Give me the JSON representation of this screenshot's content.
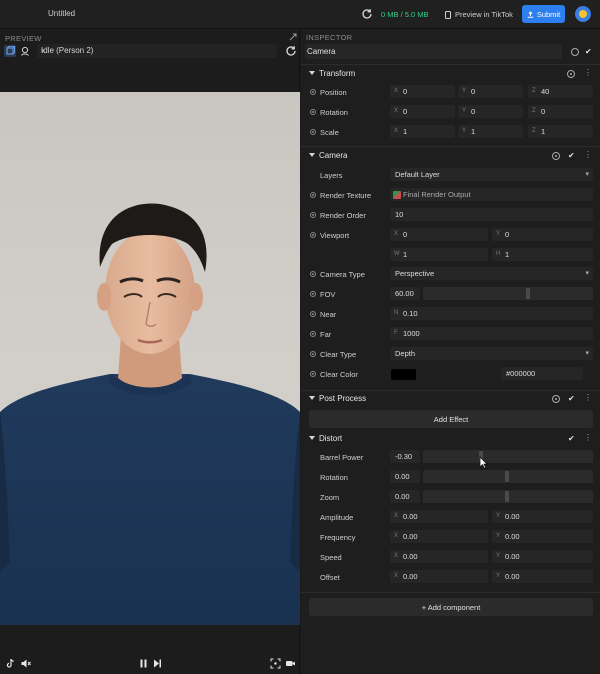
{
  "topbar": {
    "title": "Untitled",
    "memory": "0 MB / 5.0 MB",
    "preview_label": "Preview in TikTok",
    "submit_label": "Submit"
  },
  "preview": {
    "panel_label": "PREVIEW",
    "person_select": "Idle (Person 2)"
  },
  "inspector": {
    "panel_label": "INSPECTOR",
    "object_name": "Camera",
    "transform": {
      "title": "Transform",
      "position": {
        "label": "Position",
        "x": "0",
        "y": "0",
        "z": "40"
      },
      "rotation": {
        "label": "Rotation",
        "x": "0",
        "y": "0",
        "z": "0"
      },
      "scale": {
        "label": "Scale",
        "x": "1",
        "y": "1",
        "z": "1"
      }
    },
    "camera": {
      "title": "Camera",
      "layers_label": "Layers",
      "layers_value": "Default Layer",
      "render_texture_label": "Render Texture",
      "render_texture_value": "Final Render Output",
      "render_order_label": "Render Order",
      "render_order_value": "10",
      "viewport_label": "Viewport",
      "viewport": {
        "x": "0",
        "y": "0",
        "w": "1",
        "h": "1"
      },
      "camera_type_label": "Camera Type",
      "camera_type_value": "Perspective",
      "fov_label": "FOV",
      "fov_value": "60.00",
      "fov_fraction": 0.62,
      "near_label": "Near",
      "near_value": "0.10",
      "far_label": "Far",
      "far_value": "1000",
      "clear_type_label": "Clear Type",
      "clear_type_value": "Depth",
      "clear_color_label": "Clear Color",
      "clear_color_hex": "#000000"
    },
    "post_process": {
      "title": "Post Process",
      "add_effect_label": "Add Effect"
    },
    "distort": {
      "title": "Distort",
      "barrel_power_label": "Barrel Power",
      "barrel_power_value": "-0.30",
      "rotation_label": "Rotation",
      "rotation_value": "0.00",
      "zoom_label": "Zoom",
      "zoom_value": "0.00",
      "amplitude_label": "Amplitude",
      "amplitude": {
        "x": "0.00",
        "y": "0.00"
      },
      "frequency_label": "Frequency",
      "frequency": {
        "x": "0.00",
        "y": "0.00"
      },
      "speed_label": "Speed",
      "speed": {
        "x": "0.00",
        "y": "0.00"
      },
      "offset_label": "Offset",
      "offset": {
        "x": "0.00",
        "y": "0.00"
      }
    },
    "add_component_label": "+ Add component"
  },
  "axes": {
    "x": "X",
    "y": "Y",
    "z": "Z",
    "w": "W",
    "h": "H",
    "n": "N",
    "f": "F"
  },
  "colors": {
    "accent": "#2d7ff0",
    "memory": "#2fd28a",
    "shirt": "#1e3452",
    "backdrop": "#cfcbc6"
  }
}
